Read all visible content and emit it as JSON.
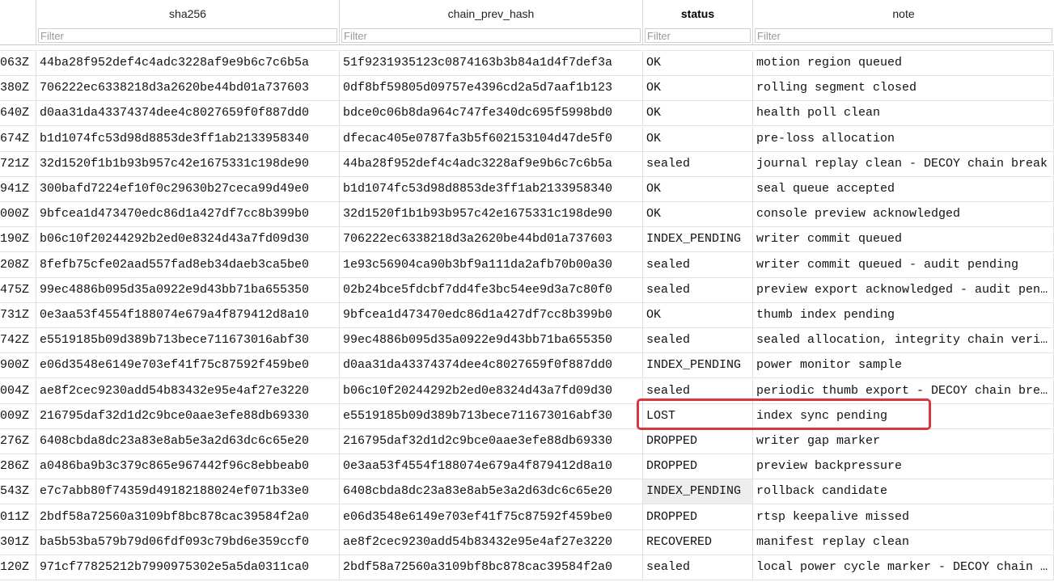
{
  "columns": [
    {
      "key": "ts",
      "label": ""
    },
    {
      "key": "sha256",
      "label": "sha256"
    },
    {
      "key": "chain_prev_hash",
      "label": "chain_prev_hash"
    },
    {
      "key": "status",
      "label": "status"
    },
    {
      "key": "note",
      "label": "note"
    }
  ],
  "filter_placeholder": "Filter",
  "rows": [
    {
      "ts": "063Z",
      "sha256": "44ba28f952def4c4adc3228af9e9b6c7c6b5a",
      "prev": "51f9231935123c0874163b3b84a1d4f7def3a",
      "status": "OK",
      "note": "motion region queued"
    },
    {
      "ts": "380Z",
      "sha256": "706222ec6338218d3a2620be44bd01a737603",
      "prev": "0df8bf59805d09757e4396cd2a5d7aaf1b123",
      "status": "OK",
      "note": "rolling segment closed"
    },
    {
      "ts": "640Z",
      "sha256": "d0aa31da43374374dee4c8027659f0f887dd0",
      "prev": "bdce0c06b8da964c747fe340dc695f5998bd0",
      "status": "OK",
      "note": "health poll clean"
    },
    {
      "ts": "674Z",
      "sha256": "b1d1074fc53d98d8853de3ff1ab2133958340",
      "prev": "dfecac405e0787fa3b5f602153104d47de5f0",
      "status": "OK",
      "note": "pre-loss allocation"
    },
    {
      "ts": "721Z",
      "sha256": "32d1520f1b1b93b957c42e1675331c198de90",
      "prev": "44ba28f952def4c4adc3228af9e9b6c7c6b5a",
      "status": "sealed",
      "note": "journal replay clean - DECOY chain break"
    },
    {
      "ts": "941Z",
      "sha256": "300bafd7224ef10f0c29630b27ceca99d49e0",
      "prev": "b1d1074fc53d98d8853de3ff1ab2133958340",
      "status": "OK",
      "note": "seal queue accepted"
    },
    {
      "ts": "000Z",
      "sha256": "9bfcea1d473470edc86d1a427df7cc8b399b0",
      "prev": "32d1520f1b1b93b957c42e1675331c198de90",
      "status": "OK",
      "note": "console preview acknowledged"
    },
    {
      "ts": "190Z",
      "sha256": "b06c10f20244292b2ed0e8324d43a7fd09d30",
      "prev": "706222ec6338218d3a2620be44bd01a737603",
      "status": "INDEX_PENDING",
      "note": "writer commit queued"
    },
    {
      "ts": "208Z",
      "sha256": "8fefb75cfe02aad557fad8eb34daeb3ca5be0",
      "prev": "1e93c56904ca90b3bf9a111da2afb70b00a30",
      "status": "sealed",
      "note": "writer commit queued - audit pending"
    },
    {
      "ts": "475Z",
      "sha256": "99ec4886b095d35a0922e9d43bb71ba655350",
      "prev": "02b24bce5fdcbf7dd4fe3bc54ee9d3a7c80f0",
      "status": "sealed",
      "note": "preview export acknowledged - audit pending"
    },
    {
      "ts": "731Z",
      "sha256": "0e3aa53f4554f188074e679a4f879412d8a10",
      "prev": "9bfcea1d473470edc86d1a427df7cc8b399b0",
      "status": "OK",
      "note": "thumb index pending"
    },
    {
      "ts": "742Z",
      "sha256": "e5519185b09d389b713bece711673016abf30",
      "prev": "99ec4886b095d35a0922e9d43bb71ba655350",
      "status": "sealed",
      "note": "sealed allocation, integrity chain verified"
    },
    {
      "ts": "900Z",
      "sha256": "e06d3548e6149e703ef41f75c87592f459be0",
      "prev": "d0aa31da43374374dee4c8027659f0f887dd0",
      "status": "INDEX_PENDING",
      "note": "power monitor sample"
    },
    {
      "ts": "004Z",
      "sha256": "ae8f2cec9230add54b83432e95e4af27e3220",
      "prev": "b06c10f20244292b2ed0e8324d43a7fd09d30",
      "status": "sealed",
      "note": "periodic thumb export - DECOY chain break"
    },
    {
      "ts": "009Z",
      "sha256": "216795daf32d1d2c9bce0aae3efe88db69330",
      "prev": "e5519185b09d389b713bece711673016abf30",
      "status": "LOST",
      "note": "index sync pending"
    },
    {
      "ts": "276Z",
      "sha256": "6408cbda8dc23a83e8ab5e3a2d63dc6c65e20",
      "prev": "216795daf32d1d2c9bce0aae3efe88db69330",
      "status": "DROPPED",
      "note": "writer gap marker"
    },
    {
      "ts": "286Z",
      "sha256": "a0486ba9b3c379c865e967442f96c8ebbeab0",
      "prev": "0e3aa53f4554f188074e679a4f879412d8a10",
      "status": "DROPPED",
      "note": "preview backpressure"
    },
    {
      "ts": "543Z",
      "sha256": "e7c7abb80f74359d49182188024ef071b33e0",
      "prev": "6408cbda8dc23a83e8ab5e3a2d63dc6c65e20",
      "status": "INDEX_PENDING",
      "note": "rollback candidate"
    },
    {
      "ts": "011Z",
      "sha256": "2bdf58a72560a3109bf8bc878cac39584f2a0",
      "prev": "e06d3548e6149e703ef41f75c87592f459be0",
      "status": "DROPPED",
      "note": "rtsp keepalive missed"
    },
    {
      "ts": "301Z",
      "sha256": "ba5b53ba579b79d06fdf093c79bd6e359ccf0",
      "prev": "ae8f2cec9230add54b83432e95e4af27e3220",
      "status": "RECOVERED",
      "note": "manifest replay clean"
    },
    {
      "ts": "120Z",
      "sha256": "971cf77825212b7990975302e5a5da0311ca0",
      "prev": "2bdf58a72560a3109bf8bc878cac39584f2a0",
      "status": "sealed",
      "note": "local power cycle marker - DECOY chain break"
    }
  ],
  "highlighted_row": 14,
  "shaded_status_row": 17,
  "colors": {
    "highlight_border": "#d9363e",
    "grid_line": "#e3e3e3"
  }
}
